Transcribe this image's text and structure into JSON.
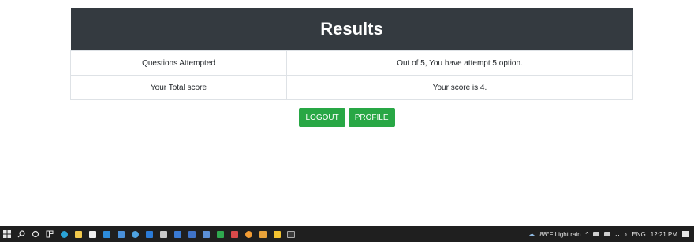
{
  "results": {
    "title": "Results",
    "rows": [
      {
        "label": "Questions Attempted",
        "value": "Out of 5, You have attempt 5 option."
      },
      {
        "label": "Your Total score",
        "value": "Your score is 4."
      }
    ]
  },
  "actions": {
    "logout_label": "LOGOUT",
    "profile_label": "PROFILE"
  },
  "taskbar": {
    "weather": "88°F Light rain",
    "language": "ENG",
    "time": "12:21 PM",
    "icons": [
      "windows-start",
      "search",
      "task-view",
      "widgets",
      "edge",
      "file-explorer",
      "store",
      "mail",
      "terminal",
      "chrome",
      "vscode",
      "app",
      "app",
      "app",
      "app",
      "app",
      "app",
      "app",
      "app",
      "app",
      "app"
    ]
  },
  "colors": {
    "header_bg": "#343a40",
    "button_bg": "#28a745",
    "taskbar_bg": "#1f1f1f"
  }
}
